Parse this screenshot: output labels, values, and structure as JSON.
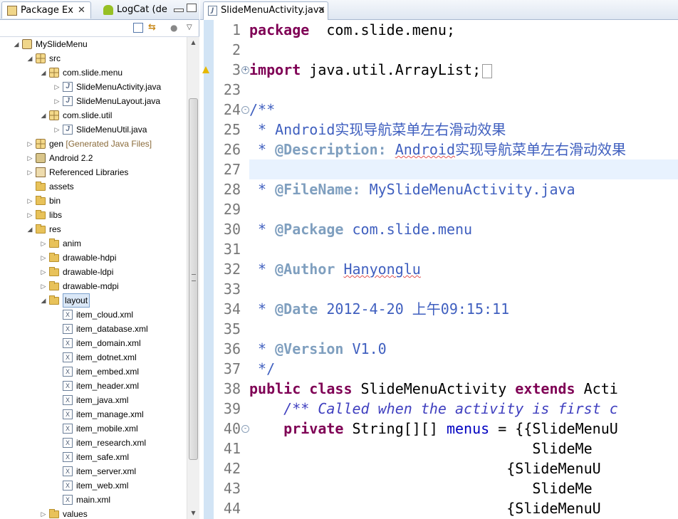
{
  "left_view": {
    "tabs": [
      {
        "label": "Package Ex",
        "icon": "package-explorer-icon",
        "active": true
      },
      {
        "label": "LogCat (de",
        "icon": "android-icon",
        "active": false
      }
    ],
    "toolbar": [
      "collapse-all-icon",
      "link-with-editor-icon",
      "view-menu-icon",
      "view-dropdown-icon"
    ],
    "tree": [
      {
        "label": "MySlideMenu",
        "decoration": "",
        "icon": "project",
        "depth": 0,
        "expanded": true
      },
      {
        "label": "src",
        "decoration": "",
        "icon": "src",
        "depth": 1,
        "expanded": true
      },
      {
        "label": "com.slide.menu",
        "decoration": "",
        "icon": "package",
        "depth": 2,
        "expanded": true
      },
      {
        "label": "SlideMenuActivity.java",
        "decoration": "",
        "icon": "java",
        "depth": 3,
        "expanded": false
      },
      {
        "label": "SlideMenuLayout.java",
        "decoration": "",
        "icon": "java",
        "depth": 3,
        "expanded": false
      },
      {
        "label": "com.slide.util",
        "decoration": "",
        "icon": "package",
        "depth": 2,
        "expanded": true
      },
      {
        "label": "SlideMenuUtil.java",
        "decoration": "",
        "icon": "java",
        "depth": 3,
        "expanded": false
      },
      {
        "label": "gen",
        "decoration": "[Generated Java Files]",
        "icon": "src",
        "depth": 1,
        "expanded": false
      },
      {
        "label": "Android 2.2",
        "decoration": "",
        "icon": "jar",
        "depth": 1,
        "expanded": false
      },
      {
        "label": "Referenced Libraries",
        "decoration": "",
        "icon": "lib",
        "depth": 1,
        "expanded": false
      },
      {
        "label": "assets",
        "decoration": "",
        "icon": "folder",
        "depth": 1,
        "expanded": null
      },
      {
        "label": "bin",
        "decoration": "",
        "icon": "folder",
        "depth": 1,
        "expanded": false
      },
      {
        "label": "libs",
        "decoration": "",
        "icon": "folder",
        "depth": 1,
        "expanded": false
      },
      {
        "label": "res",
        "decoration": "",
        "icon": "folder",
        "depth": 1,
        "expanded": true
      },
      {
        "label": "anim",
        "decoration": "",
        "icon": "folder",
        "depth": 2,
        "expanded": false
      },
      {
        "label": "drawable-hdpi",
        "decoration": "",
        "icon": "folder",
        "depth": 2,
        "expanded": false
      },
      {
        "label": "drawable-ldpi",
        "decoration": "",
        "icon": "folder",
        "depth": 2,
        "expanded": false
      },
      {
        "label": "drawable-mdpi",
        "decoration": "",
        "icon": "folder",
        "depth": 2,
        "expanded": false
      },
      {
        "label": "layout",
        "decoration": "",
        "icon": "folder",
        "depth": 2,
        "expanded": true,
        "selected": true
      },
      {
        "label": "item_cloud.xml",
        "decoration": "",
        "icon": "xml",
        "depth": 3,
        "expanded": null
      },
      {
        "label": "item_database.xml",
        "decoration": "",
        "icon": "xml",
        "depth": 3,
        "expanded": null
      },
      {
        "label": "item_domain.xml",
        "decoration": "",
        "icon": "xml",
        "depth": 3,
        "expanded": null
      },
      {
        "label": "item_dotnet.xml",
        "decoration": "",
        "icon": "xml",
        "depth": 3,
        "expanded": null
      },
      {
        "label": "item_embed.xml",
        "decoration": "",
        "icon": "xml",
        "depth": 3,
        "expanded": null
      },
      {
        "label": "item_header.xml",
        "decoration": "",
        "icon": "xml",
        "depth": 3,
        "expanded": null
      },
      {
        "label": "item_java.xml",
        "decoration": "",
        "icon": "xml",
        "depth": 3,
        "expanded": null
      },
      {
        "label": "item_manage.xml",
        "decoration": "",
        "icon": "xml",
        "depth": 3,
        "expanded": null
      },
      {
        "label": "item_mobile.xml",
        "decoration": "",
        "icon": "xml",
        "depth": 3,
        "expanded": null
      },
      {
        "label": "item_research.xml",
        "decoration": "",
        "icon": "xml",
        "depth": 3,
        "expanded": null
      },
      {
        "label": "item_safe.xml",
        "decoration": "",
        "icon": "xml",
        "depth": 3,
        "expanded": null
      },
      {
        "label": "item_server.xml",
        "decoration": "",
        "icon": "xml",
        "depth": 3,
        "expanded": null
      },
      {
        "label": "item_web.xml",
        "decoration": "",
        "icon": "xml",
        "depth": 3,
        "expanded": null
      },
      {
        "label": "main.xml",
        "decoration": "",
        "icon": "xml",
        "depth": 3,
        "expanded": null
      },
      {
        "label": "values",
        "decoration": "",
        "icon": "folder",
        "depth": 2,
        "expanded": false
      }
    ]
  },
  "editor": {
    "tab": {
      "label": "SlideMenuActivity.java",
      "icon": "java-file-icon"
    },
    "lines": [
      {
        "n": "1",
        "marker": "",
        "fold": "",
        "parts": [
          [
            "kw",
            "package"
          ],
          [
            "",
            "  com.slide.menu;"
          ]
        ]
      },
      {
        "n": "2",
        "marker": "",
        "fold": "",
        "parts": []
      },
      {
        "n": "3",
        "marker": "warning",
        "fold": "+",
        "parts": [
          [
            "kw",
            "import"
          ],
          [
            "",
            " java.util.ArrayList;"
          ],
          [
            "box",
            ""
          ]
        ]
      },
      {
        "n": "23",
        "marker": "",
        "fold": "",
        "parts": []
      },
      {
        "n": "24",
        "marker": "",
        "fold": "-",
        "parts": [
          [
            "cm",
            "/**"
          ]
        ]
      },
      {
        "n": "25",
        "marker": "",
        "fold": "",
        "parts": [
          [
            "cm",
            " * Android实现导航菜单左右滑动效果"
          ]
        ]
      },
      {
        "n": "26",
        "marker": "",
        "fold": "",
        "parts": [
          [
            "cm",
            " * "
          ],
          [
            "tag",
            "@Description:"
          ],
          [
            "cm",
            " "
          ],
          [
            "cmw",
            "Android"
          ],
          [
            "cm",
            "实现导航菜单左右滑动效果"
          ]
        ]
      },
      {
        "n": "27",
        "marker": "",
        "fold": "",
        "parts": [],
        "highlight": true
      },
      {
        "n": "28",
        "marker": "",
        "fold": "",
        "parts": [
          [
            "cm",
            " * "
          ],
          [
            "tag",
            "@FileName:"
          ],
          [
            "cm",
            " MySlideMenuActivity.java"
          ]
        ]
      },
      {
        "n": "29",
        "marker": "",
        "fold": "",
        "parts": []
      },
      {
        "n": "30",
        "marker": "",
        "fold": "",
        "parts": [
          [
            "cm",
            " * "
          ],
          [
            "tag",
            "@Package"
          ],
          [
            "cm",
            " com.slide.menu"
          ]
        ]
      },
      {
        "n": "31",
        "marker": "",
        "fold": "",
        "parts": []
      },
      {
        "n": "32",
        "marker": "",
        "fold": "",
        "parts": [
          [
            "cm",
            " * "
          ],
          [
            "tag",
            "@Author"
          ],
          [
            "cm",
            " "
          ],
          [
            "cmw",
            "Hanyonglu"
          ]
        ]
      },
      {
        "n": "33",
        "marker": "",
        "fold": "",
        "parts": []
      },
      {
        "n": "34",
        "marker": "",
        "fold": "",
        "parts": [
          [
            "cm",
            " * "
          ],
          [
            "tag",
            "@Date"
          ],
          [
            "cm",
            " 2012-4-20 上午09:15:11"
          ]
        ]
      },
      {
        "n": "35",
        "marker": "",
        "fold": "",
        "parts": []
      },
      {
        "n": "36",
        "marker": "",
        "fold": "",
        "parts": [
          [
            "cm",
            " * "
          ],
          [
            "tag",
            "@Version"
          ],
          [
            "cm",
            " V1.0"
          ]
        ]
      },
      {
        "n": "37",
        "marker": "",
        "fold": "",
        "parts": [
          [
            "cm",
            " */"
          ]
        ]
      },
      {
        "n": "38",
        "marker": "",
        "fold": "",
        "parts": [
          [
            "kw",
            "public"
          ],
          [
            "",
            " "
          ],
          [
            "kw",
            "class"
          ],
          [
            "",
            " SlideMenuActivity "
          ],
          [
            "kw",
            "extends"
          ],
          [
            "",
            " Acti"
          ]
        ]
      },
      {
        "n": "39",
        "marker": "",
        "fold": "",
        "parts": [
          [
            "",
            "    "
          ],
          [
            "jd",
            "/** Called when the activity is first c"
          ]
        ]
      },
      {
        "n": "40",
        "marker": "",
        "fold": "-",
        "parts": [
          [
            "",
            "    "
          ],
          [
            "kw",
            "private"
          ],
          [
            "",
            " String[][] "
          ],
          [
            "fld",
            "menus"
          ],
          [
            "",
            " = {{SlideMenuU"
          ]
        ]
      },
      {
        "n": "41",
        "marker": "",
        "fold": "",
        "parts": [
          [
            "",
            "                                 SlideMe"
          ]
        ]
      },
      {
        "n": "42",
        "marker": "",
        "fold": "",
        "parts": [
          [
            "",
            "                              {SlideMenuU"
          ]
        ]
      },
      {
        "n": "43",
        "marker": "",
        "fold": "",
        "parts": [
          [
            "",
            "                                 SlideMe"
          ]
        ]
      },
      {
        "n": "44",
        "marker": "",
        "fold": "",
        "parts": [
          [
            "",
            "                              {SlideMenuU"
          ]
        ]
      }
    ]
  },
  "colors": {
    "keyword": "#7f0055",
    "comment": "#3f5fbf",
    "javadoc_tag": "#7f9fbf",
    "field": "#0000c0",
    "line_number": "#787878",
    "current_line": "#e8f2fe",
    "selection": "#dbe8f7"
  }
}
